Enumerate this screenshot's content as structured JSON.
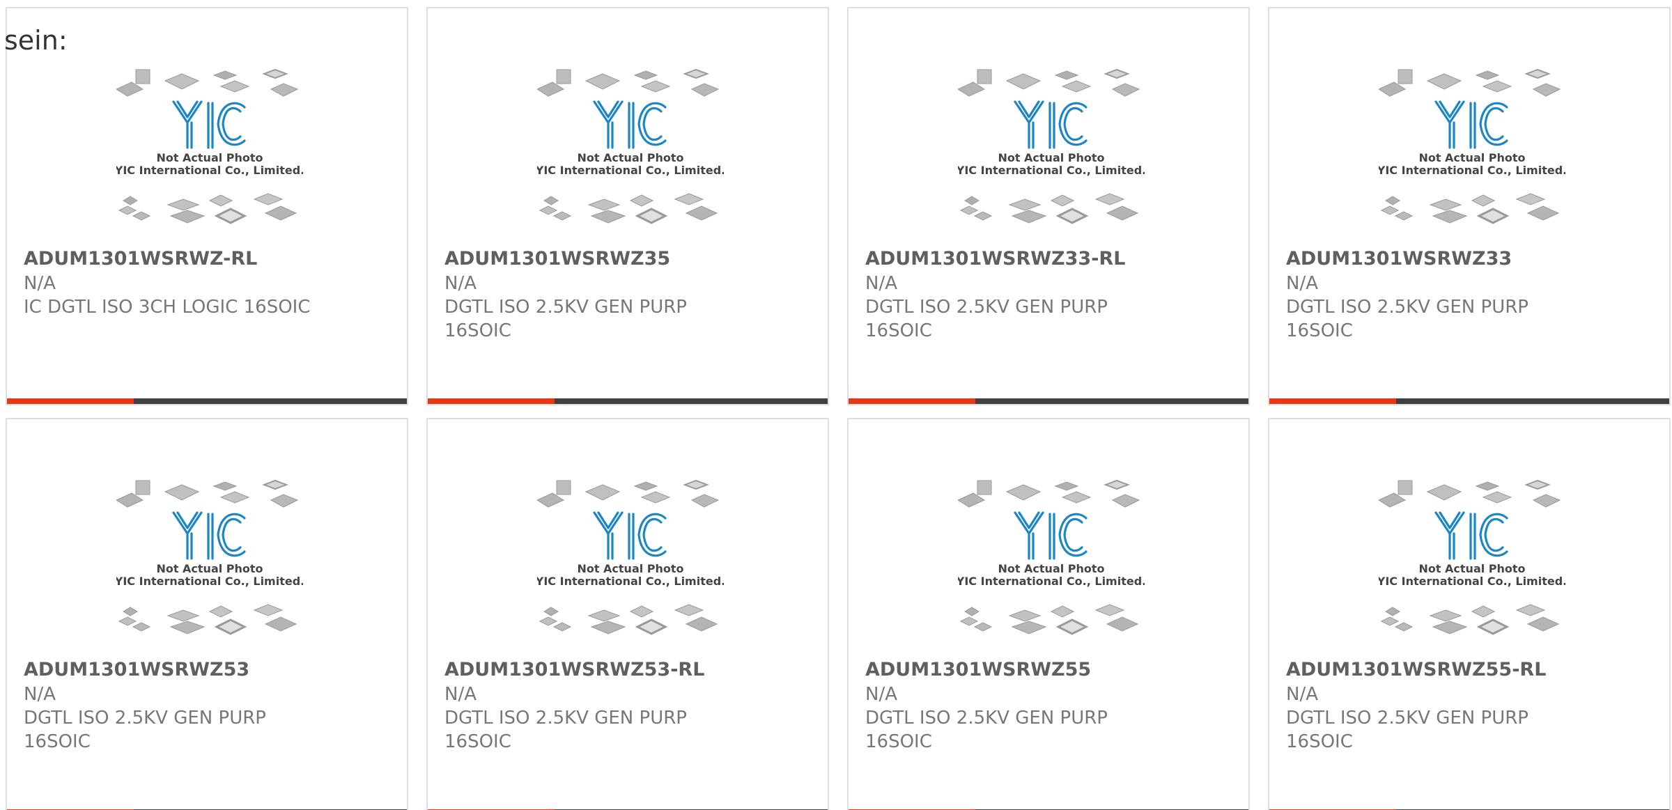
{
  "intro": {
    "label": "sein:"
  },
  "thumbnail": {
    "logo_text": "YIC",
    "caption_line1": "Not Actual Photo",
    "caption_line2": "YIC International Co., Limited."
  },
  "colors": {
    "accent": "#e33a1a",
    "bar": "#404040",
    "logo_blue": "#1a86c8",
    "card_border": "#dedede"
  },
  "products": [
    {
      "part": "ADUM1301WSRWZ-RL",
      "manufacturer": "N/A",
      "description": "IC DGTL ISO 3CH LOGIC 16SOIC"
    },
    {
      "part": "ADUM1301WSRWZ35",
      "manufacturer": "N/A",
      "description": "DGTL ISO 2.5KV GEN PURP 16SOIC"
    },
    {
      "part": "ADUM1301WSRWZ33-RL",
      "manufacturer": "N/A",
      "description": "DGTL ISO 2.5KV GEN PURP 16SOIC"
    },
    {
      "part": "ADUM1301WSRWZ33",
      "manufacturer": "N/A",
      "description": "DGTL ISO 2.5KV GEN PURP 16SOIC"
    },
    {
      "part": "ADUM1301WSRWZ53",
      "manufacturer": "N/A",
      "description": "DGTL ISO 2.5KV GEN PURP 16SOIC"
    },
    {
      "part": "ADUM1301WSRWZ53-RL",
      "manufacturer": "N/A",
      "description": "DGTL ISO 2.5KV GEN PURP 16SOIC"
    },
    {
      "part": "ADUM1301WSRWZ55",
      "manufacturer": "N/A",
      "description": "DGTL ISO 2.5KV GEN PURP 16SOIC"
    },
    {
      "part": "ADUM1301WSRWZ55-RL",
      "manufacturer": "N/A",
      "description": "DGTL ISO 2.5KV GEN PURP 16SOIC"
    }
  ]
}
